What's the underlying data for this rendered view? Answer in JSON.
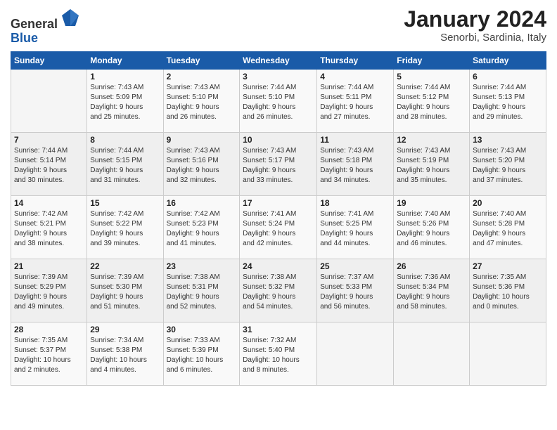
{
  "header": {
    "logo_line1": "General",
    "logo_line2": "Blue",
    "month": "January 2024",
    "location": "Senorbi, Sardinia, Italy"
  },
  "weekdays": [
    "Sunday",
    "Monday",
    "Tuesday",
    "Wednesday",
    "Thursday",
    "Friday",
    "Saturday"
  ],
  "weeks": [
    [
      {
        "day": "",
        "info": ""
      },
      {
        "day": "1",
        "info": "Sunrise: 7:43 AM\nSunset: 5:09 PM\nDaylight: 9 hours\nand 25 minutes."
      },
      {
        "day": "2",
        "info": "Sunrise: 7:43 AM\nSunset: 5:10 PM\nDaylight: 9 hours\nand 26 minutes."
      },
      {
        "day": "3",
        "info": "Sunrise: 7:44 AM\nSunset: 5:10 PM\nDaylight: 9 hours\nand 26 minutes."
      },
      {
        "day": "4",
        "info": "Sunrise: 7:44 AM\nSunset: 5:11 PM\nDaylight: 9 hours\nand 27 minutes."
      },
      {
        "day": "5",
        "info": "Sunrise: 7:44 AM\nSunset: 5:12 PM\nDaylight: 9 hours\nand 28 minutes."
      },
      {
        "day": "6",
        "info": "Sunrise: 7:44 AM\nSunset: 5:13 PM\nDaylight: 9 hours\nand 29 minutes."
      }
    ],
    [
      {
        "day": "7",
        "info": "Sunrise: 7:44 AM\nSunset: 5:14 PM\nDaylight: 9 hours\nand 30 minutes."
      },
      {
        "day": "8",
        "info": "Sunrise: 7:44 AM\nSunset: 5:15 PM\nDaylight: 9 hours\nand 31 minutes."
      },
      {
        "day": "9",
        "info": "Sunrise: 7:43 AM\nSunset: 5:16 PM\nDaylight: 9 hours\nand 32 minutes."
      },
      {
        "day": "10",
        "info": "Sunrise: 7:43 AM\nSunset: 5:17 PM\nDaylight: 9 hours\nand 33 minutes."
      },
      {
        "day": "11",
        "info": "Sunrise: 7:43 AM\nSunset: 5:18 PM\nDaylight: 9 hours\nand 34 minutes."
      },
      {
        "day": "12",
        "info": "Sunrise: 7:43 AM\nSunset: 5:19 PM\nDaylight: 9 hours\nand 35 minutes."
      },
      {
        "day": "13",
        "info": "Sunrise: 7:43 AM\nSunset: 5:20 PM\nDaylight: 9 hours\nand 37 minutes."
      }
    ],
    [
      {
        "day": "14",
        "info": "Sunrise: 7:42 AM\nSunset: 5:21 PM\nDaylight: 9 hours\nand 38 minutes."
      },
      {
        "day": "15",
        "info": "Sunrise: 7:42 AM\nSunset: 5:22 PM\nDaylight: 9 hours\nand 39 minutes."
      },
      {
        "day": "16",
        "info": "Sunrise: 7:42 AM\nSunset: 5:23 PM\nDaylight: 9 hours\nand 41 minutes."
      },
      {
        "day": "17",
        "info": "Sunrise: 7:41 AM\nSunset: 5:24 PM\nDaylight: 9 hours\nand 42 minutes."
      },
      {
        "day": "18",
        "info": "Sunrise: 7:41 AM\nSunset: 5:25 PM\nDaylight: 9 hours\nand 44 minutes."
      },
      {
        "day": "19",
        "info": "Sunrise: 7:40 AM\nSunset: 5:26 PM\nDaylight: 9 hours\nand 46 minutes."
      },
      {
        "day": "20",
        "info": "Sunrise: 7:40 AM\nSunset: 5:28 PM\nDaylight: 9 hours\nand 47 minutes."
      }
    ],
    [
      {
        "day": "21",
        "info": "Sunrise: 7:39 AM\nSunset: 5:29 PM\nDaylight: 9 hours\nand 49 minutes."
      },
      {
        "day": "22",
        "info": "Sunrise: 7:39 AM\nSunset: 5:30 PM\nDaylight: 9 hours\nand 51 minutes."
      },
      {
        "day": "23",
        "info": "Sunrise: 7:38 AM\nSunset: 5:31 PM\nDaylight: 9 hours\nand 52 minutes."
      },
      {
        "day": "24",
        "info": "Sunrise: 7:38 AM\nSunset: 5:32 PM\nDaylight: 9 hours\nand 54 minutes."
      },
      {
        "day": "25",
        "info": "Sunrise: 7:37 AM\nSunset: 5:33 PM\nDaylight: 9 hours\nand 56 minutes."
      },
      {
        "day": "26",
        "info": "Sunrise: 7:36 AM\nSunset: 5:34 PM\nDaylight: 9 hours\nand 58 minutes."
      },
      {
        "day": "27",
        "info": "Sunrise: 7:35 AM\nSunset: 5:36 PM\nDaylight: 10 hours\nand 0 minutes."
      }
    ],
    [
      {
        "day": "28",
        "info": "Sunrise: 7:35 AM\nSunset: 5:37 PM\nDaylight: 10 hours\nand 2 minutes."
      },
      {
        "day": "29",
        "info": "Sunrise: 7:34 AM\nSunset: 5:38 PM\nDaylight: 10 hours\nand 4 minutes."
      },
      {
        "day": "30",
        "info": "Sunrise: 7:33 AM\nSunset: 5:39 PM\nDaylight: 10 hours\nand 6 minutes."
      },
      {
        "day": "31",
        "info": "Sunrise: 7:32 AM\nSunset: 5:40 PM\nDaylight: 10 hours\nand 8 minutes."
      },
      {
        "day": "",
        "info": ""
      },
      {
        "day": "",
        "info": ""
      },
      {
        "day": "",
        "info": ""
      }
    ]
  ]
}
